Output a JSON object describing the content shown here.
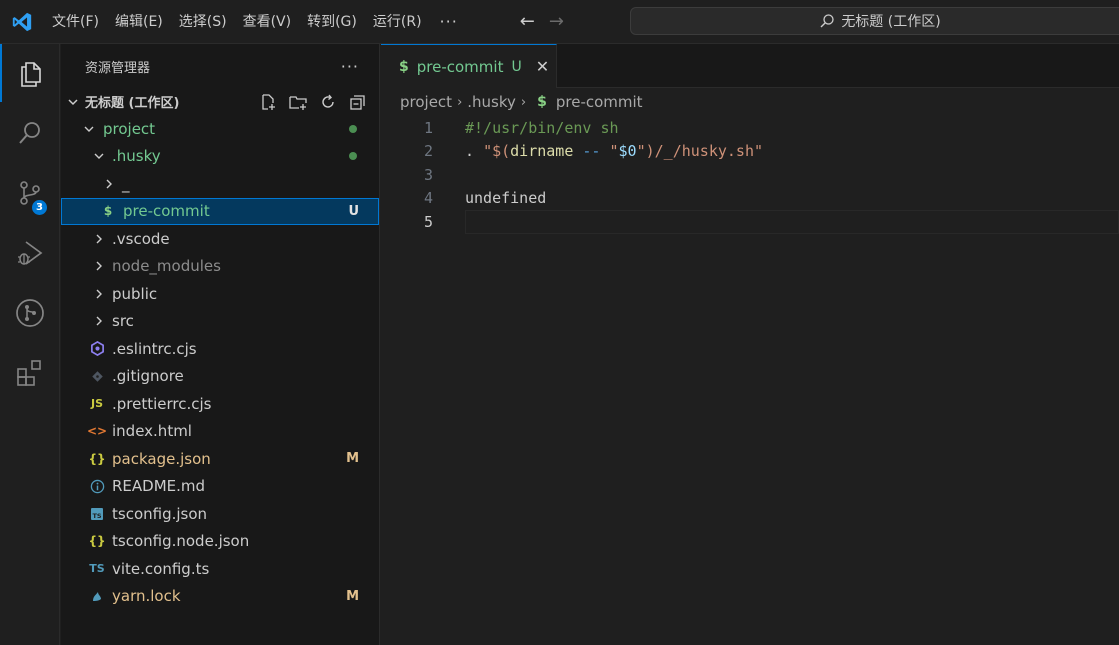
{
  "menu": {
    "file": "文件(F)",
    "edit": "编辑(E)",
    "selection": "选择(S)",
    "view": "查看(V)",
    "goto": "转到(G)",
    "run": "运行(R)",
    "more": "···"
  },
  "command_center": {
    "text": "无标题 (工作区)"
  },
  "activity": {
    "scm_badge": "3"
  },
  "sidebar": {
    "title": "资源管理器",
    "more": "···",
    "workspace": "无标题 (工作区)"
  },
  "tree": {
    "project": "project",
    "husky": ".husky",
    "underscore": "_",
    "precommit": "pre-commit",
    "precommit_deco": "U",
    "vscode": ".vscode",
    "node_modules": "node_modules",
    "public": "public",
    "src": "src",
    "eslintrc": ".eslintrc.cjs",
    "gitignore": ".gitignore",
    "prettierrc": ".prettierrc.cjs",
    "index_html": "index.html",
    "package_json": "package.json",
    "package_json_deco": "M",
    "readme": "README.md",
    "tsconfig": "tsconfig.json",
    "tsconfig_node": "tsconfig.node.json",
    "vite_config": "vite.config.ts",
    "yarn_lock": "yarn.lock",
    "yarn_lock_deco": "M",
    "icon_js": "JS",
    "icon_ts": "TS",
    "icon_braces": "{}",
    "icon_html": "<>",
    "icon_dollar": "$"
  },
  "tab": {
    "label": "pre-commit",
    "deco": "U"
  },
  "breadcrumb": {
    "part1": "project",
    "part2": ".husky",
    "part3": "pre-commit"
  },
  "code": {
    "line_numbers": [
      "1",
      "2",
      "3",
      "4",
      "5"
    ],
    "line1": "#!/usr/bin/env sh",
    "line2_a": ". ",
    "line2_b": "\"$(",
    "line2_c": "dirname",
    "line2_d": " -- ",
    "line2_e": "\"",
    "line2_f": "$0",
    "line2_g": "\"",
    "line2_h": ")/_/husky.sh\"",
    "line4": "undefined"
  }
}
